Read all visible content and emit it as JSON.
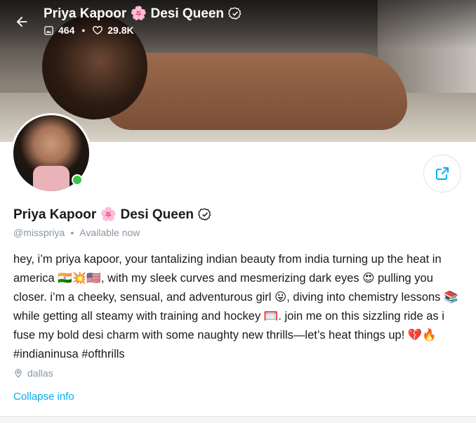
{
  "header": {
    "title": "Priya Kapoor 🌸 Desi Queen",
    "media_count": "464",
    "likes_count": "29.8K"
  },
  "profile": {
    "name": "Priya Kapoor 🌸 Desi Queen",
    "handle": "@misspriya",
    "status": "Available now",
    "bio": "hey, i’m priya kapoor, your tantalizing indian beauty from india turning up the heat in america 🇮🇳💥🇺🇸, with my sleek curves and mesmerizing dark eyes 😍 pulling you closer. i’m a cheeky, sensual, and adventurous girl 😛, diving into chemistry lessons 📚 while getting all steamy with training and hockey 🥅. join me on this sizzling ride as i fuse my bold desi charm with some naughty new thrills—let’s heat things up! 💔🔥 #indianinusa #ofthrills",
    "location": "dallas",
    "collapse_label": "Collapse info"
  },
  "colors": {
    "accent": "#00aff0",
    "muted": "#8a96a3",
    "online": "#37c74a"
  },
  "icons": {
    "back": "arrow-left-icon",
    "media": "image-icon",
    "likes": "heart-icon",
    "verified": "verified-badge-icon",
    "share": "share-icon",
    "location": "location-pin-icon"
  }
}
